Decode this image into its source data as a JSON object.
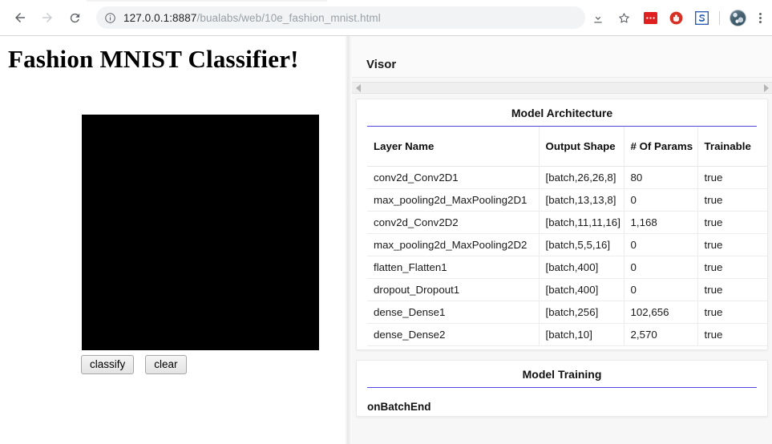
{
  "browser": {
    "back_label": "Back",
    "forward_label": "Forward",
    "reload_label": "Reload",
    "url_host": "127.0.0.1:8887",
    "url_path": "/bualabs/web/10e_fashion_mnist.html",
    "site_info_icon": "info-circle-icon",
    "download_icon": "download-icon",
    "bookmark_icon": "star-icon",
    "extensions": [
      {
        "name": "extension-red-block-icon",
        "color": "#e02020"
      },
      {
        "name": "extension-adblock-icon",
        "color": "#d93025"
      },
      {
        "name": "extension-s-icon",
        "color": "#2a5db0"
      }
    ],
    "profile_icon": "profile-globe-avatar",
    "menu_icon": "kebab-menu-icon"
  },
  "app": {
    "title": "Fashion MNIST Classifier!",
    "canvas_name": "drawing-canvas",
    "canvas_color": "#000000",
    "buttons": [
      {
        "label": "classify",
        "name": "classify-button"
      },
      {
        "label": "clear",
        "name": "clear-button"
      }
    ]
  },
  "visor": {
    "tab_label": "Visor",
    "accent_color": "#5146e0",
    "scroll_left_icon": "triangle-left-icon",
    "scroll_right_icon": "triangle-right-icon",
    "cards": [
      {
        "title": "Model Architecture",
        "columns": [
          "Layer Name",
          "Output Shape",
          "# Of Params",
          "Trainable"
        ],
        "rows": [
          [
            "conv2d_Conv2D1",
            "[batch,26,26,8]",
            "80",
            "true"
          ],
          [
            "max_pooling2d_MaxPooling2D1",
            "[batch,13,13,8]",
            "0",
            "true"
          ],
          [
            "conv2d_Conv2D2",
            "[batch,11,11,16]",
            "1,168",
            "true"
          ],
          [
            "max_pooling2d_MaxPooling2D2",
            "[batch,5,5,16]",
            "0",
            "true"
          ],
          [
            "flatten_Flatten1",
            "[batch,400]",
            "0",
            "true"
          ],
          [
            "dropout_Dropout1",
            "[batch,400]",
            "0",
            "true"
          ],
          [
            "dense_Dense1",
            "[batch,256]",
            "102,656",
            "true"
          ],
          [
            "dense_Dense2",
            "[batch,10]",
            "2,570",
            "true"
          ]
        ]
      },
      {
        "title": "Model Training",
        "section_label": "onBatchEnd"
      }
    ]
  }
}
